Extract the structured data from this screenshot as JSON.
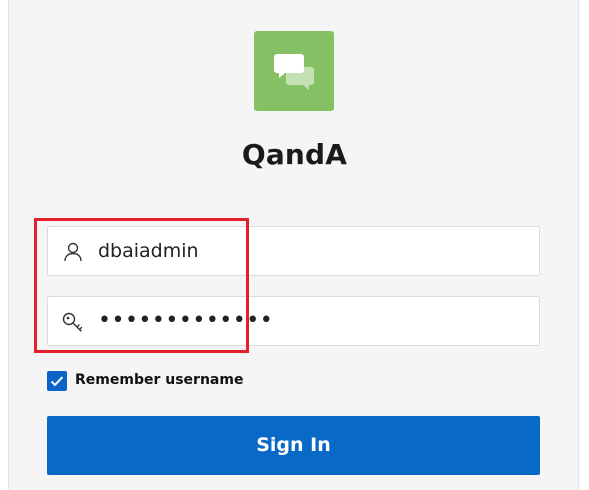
{
  "app": {
    "title": "QandA",
    "logo_icon": "chat-bubbles-icon",
    "logo_color": "#85c065"
  },
  "login": {
    "username_value": "dbaiadmin",
    "username_icon": "user-icon",
    "password_value": "•••••••••••••",
    "password_icon": "key-icon",
    "remember_label": "Remember username",
    "remember_checked": true,
    "signin_label": "Sign In"
  },
  "colors": {
    "accent": "#0969c7",
    "highlight": "#e3202a"
  }
}
